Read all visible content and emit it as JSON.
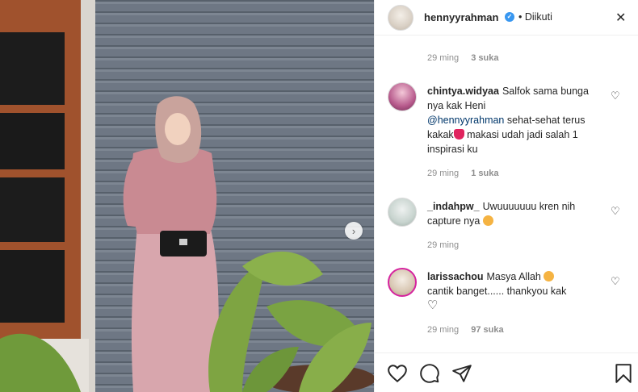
{
  "post": {
    "username": "hennyyrahman",
    "follow_status": "• Diikuti",
    "caption_meta": {
      "time": "29 ming",
      "likes": "3 suka"
    }
  },
  "comments": [
    {
      "user": "chintya.widyaa",
      "text_1": "Salfok sama bunga nya kak Heni",
      "mention": "@hennyyrahman",
      "text_2": "sehat-sehat terus kakak",
      "text_3": "makasi udah jadi salah 1 inspirasi ku",
      "time": "29 ming",
      "likes": "1 suka"
    },
    {
      "user": "_indahpw_",
      "text_1": "Uwuuuuuuu kren nih capture nya",
      "time": "29 ming"
    },
    {
      "user": "larissachou",
      "text_1": "Masya Allah",
      "text_2": "cantik banget...... thankyou kak",
      "time": "29 ming",
      "likes": "97 suka"
    }
  ],
  "icons": {
    "close": "close-icon",
    "next": "chevron-right-icon",
    "like": "heart-icon",
    "comment": "comment-icon",
    "share": "paper-plane-icon",
    "save": "bookmark-icon"
  },
  "colors": {
    "verified": "#3897f0",
    "emoji_heart": "#e0245e",
    "emoji_face": "#f5b342",
    "muted_text": "#8e8e8e"
  }
}
